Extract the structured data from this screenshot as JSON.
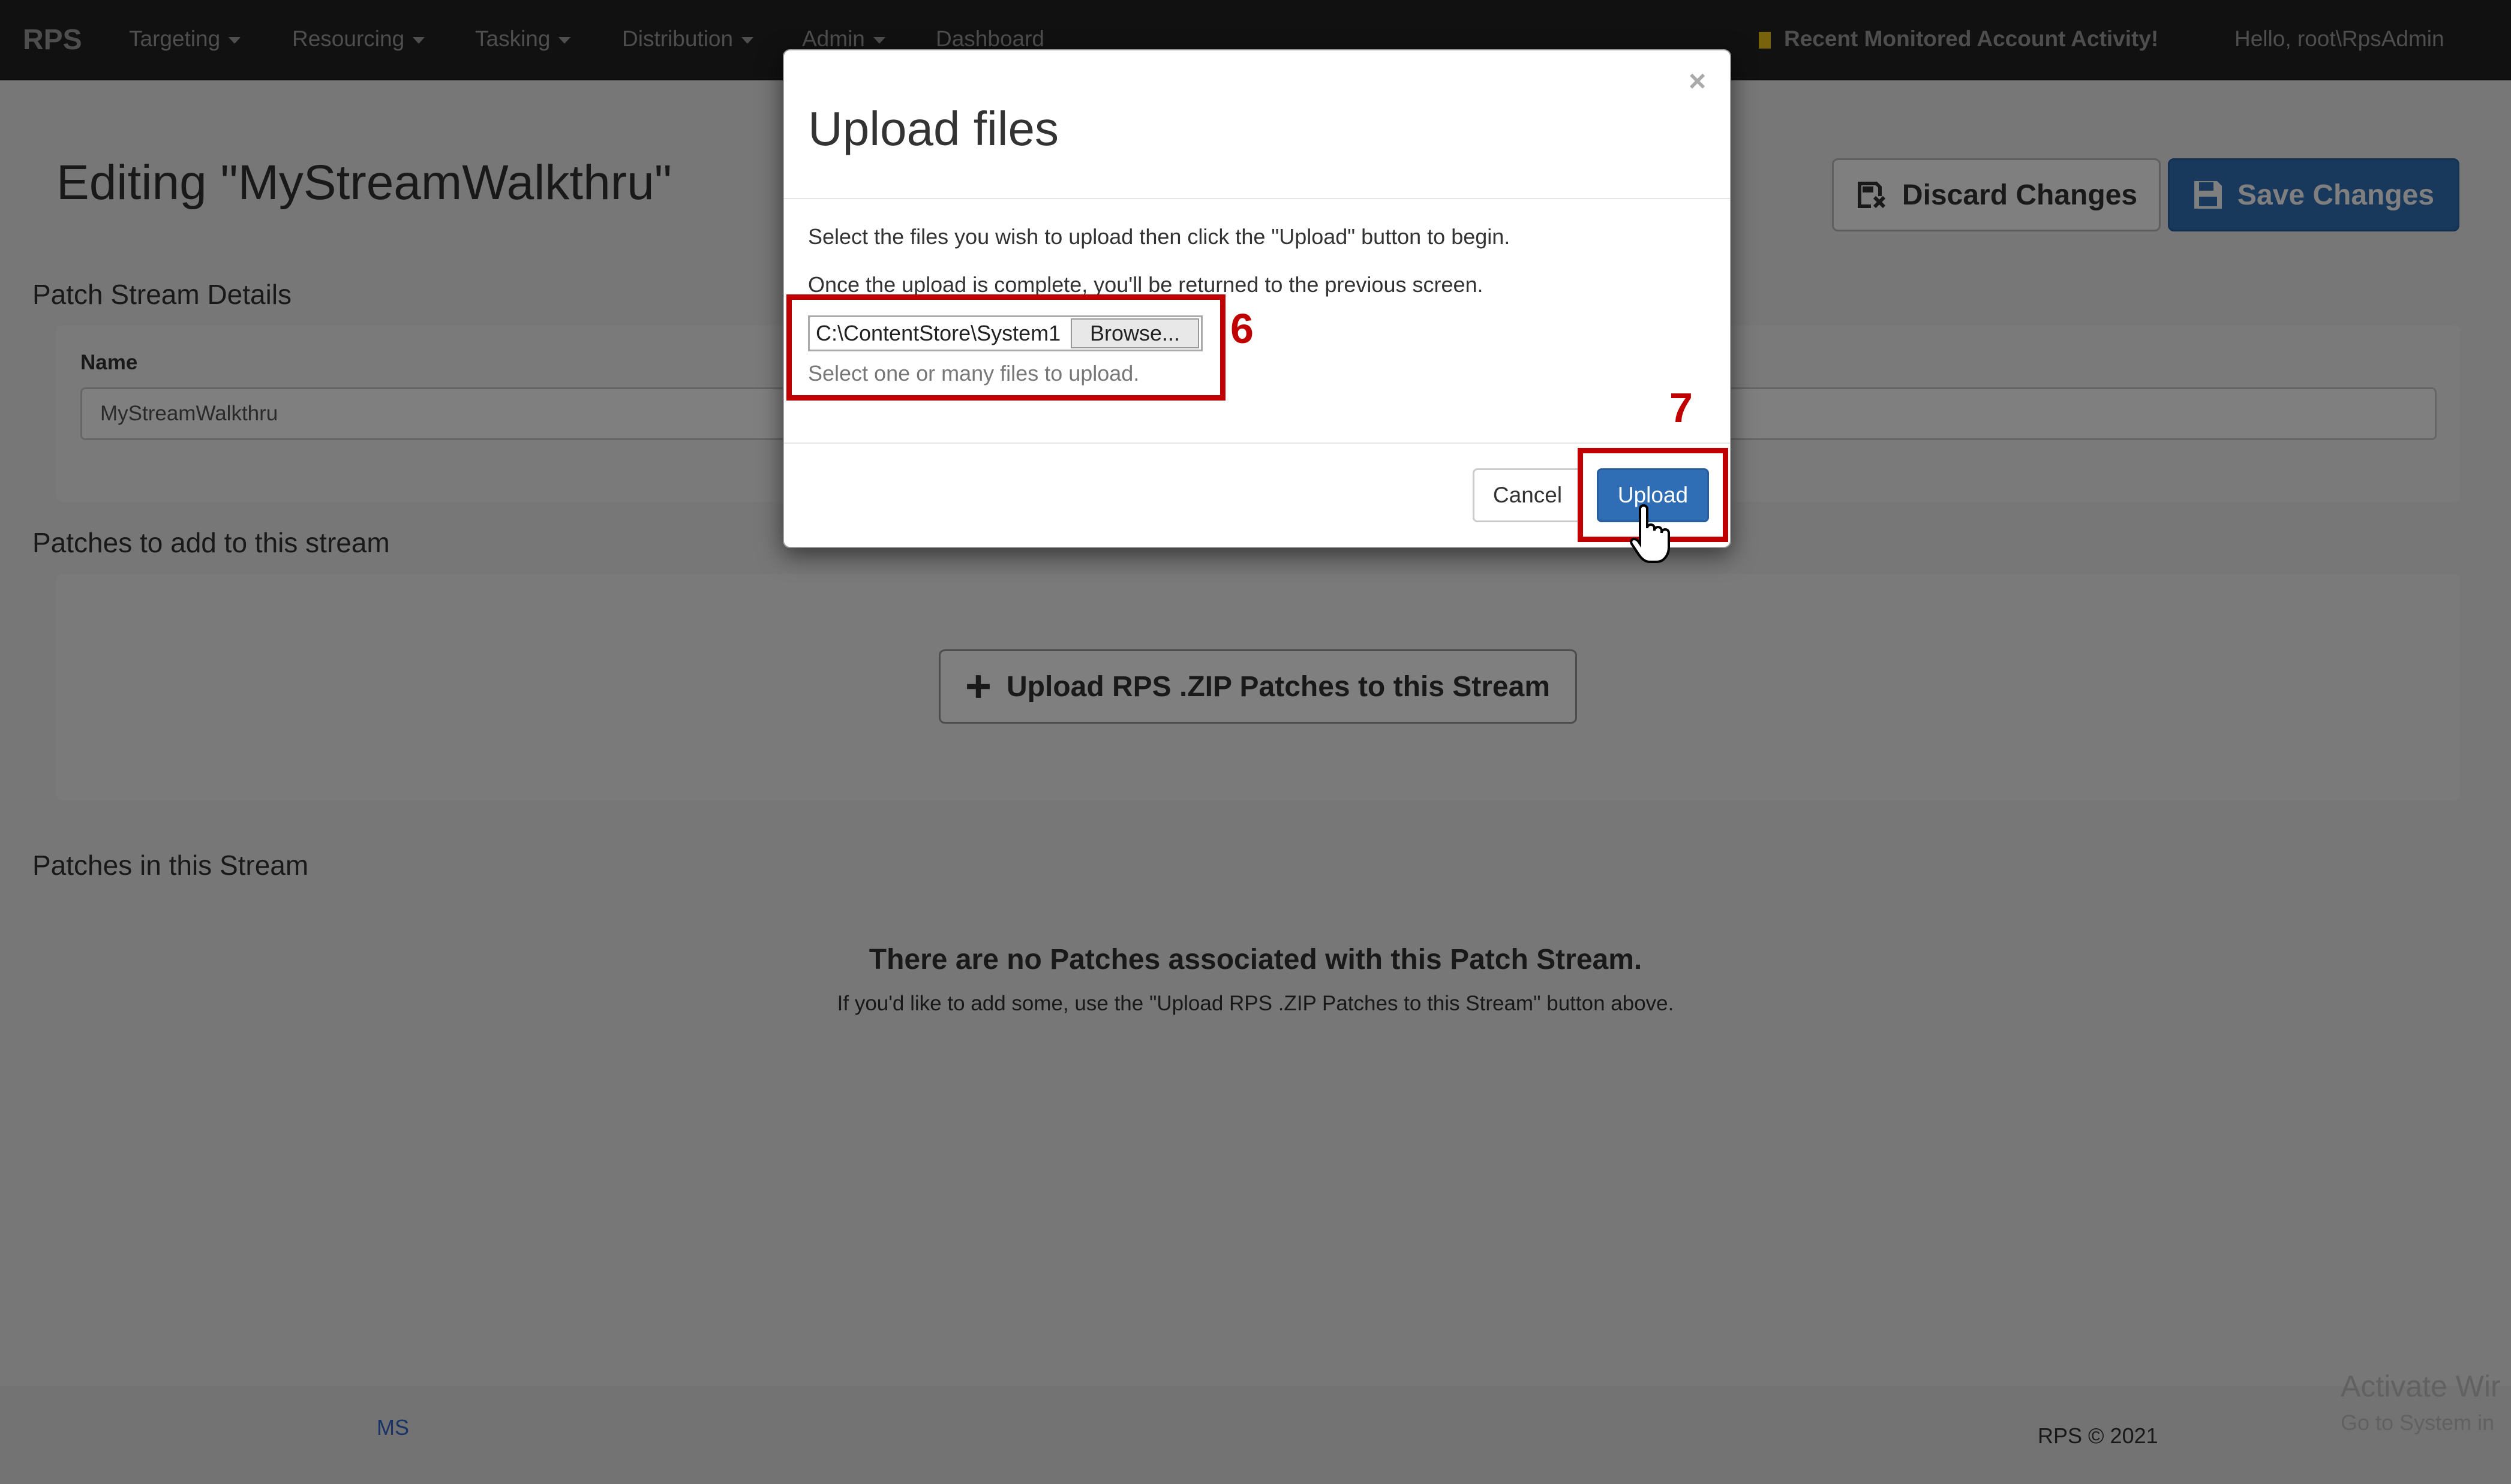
{
  "navbar": {
    "brand": "RPS",
    "items": [
      "Targeting",
      "Resourcing",
      "Tasking",
      "Distribution",
      "Admin"
    ],
    "dashboard": "Dashboard",
    "activity": "Recent Monitored Account Activity!",
    "greeting": "Hello, root\\RpsAdmin"
  },
  "page": {
    "title": "Editing \"MyStreamWalkthru\"",
    "discard_label": "Discard Changes",
    "save_label": "Save Changes",
    "details_heading": "Patch Stream Details",
    "name_label": "Name",
    "name_value": "MyStreamWalkthru",
    "add_heading": "Patches to add to this stream",
    "upload_zip_label": "Upload RPS .ZIP Patches to this Stream",
    "in_stream_heading": "Patches in this Stream",
    "empty_title": "There are no Patches associated with this Patch Stream.",
    "empty_sub": "If you'd like to add some, use the \"Upload RPS .ZIP Patches to this Stream\" button above."
  },
  "footer": {
    "left": "MS",
    "copyright": "RPS © 2021"
  },
  "watermark": {
    "line1": "Activate Wir",
    "line2": "Go to System in"
  },
  "modal": {
    "title": "Upload files",
    "close": "×",
    "line1": "Select the files you wish to upload then click the \"Upload\" button to begin.",
    "line2": "Once the upload is complete, you'll be returned to the previous screen.",
    "file_path": "C:\\ContentStore\\System1",
    "browse_label": "Browse...",
    "help": "Select one or many files to upload.",
    "cancel_label": "Cancel",
    "upload_label": "Upload"
  },
  "annotations": {
    "step6": "6",
    "step7": "7",
    "color": "#c00000"
  }
}
